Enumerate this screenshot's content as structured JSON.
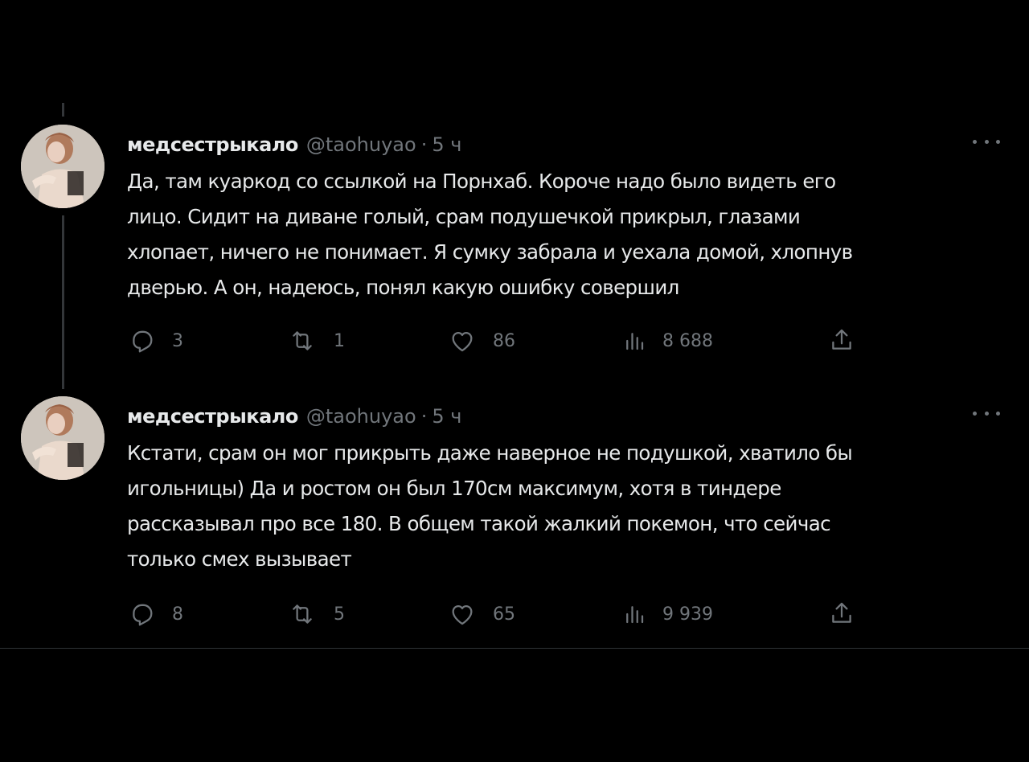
{
  "tweets": [
    {
      "display_name": "медсестрыкало",
      "handle": "@taohuyao",
      "separator": "·",
      "time": "5 ч",
      "text_lines": [
        "Да, там куаркод со ссылкой на Порнхаб. Короче надо было видеть его",
        "лицо. Сидит на диване голый, срам подушечкой прикрыл, глазами",
        "хлопает, ничего не понимает. Я сумку забрала и уехала домой, хлопнув",
        "дверью. А он, надеюсь, понял какую ошибку совершил"
      ],
      "replies": "3",
      "retweets": "1",
      "likes": "86",
      "views": "8 688"
    },
    {
      "display_name": "медсестрыкало",
      "handle": "@taohuyao",
      "separator": "·",
      "time": "5 ч",
      "text_lines": [
        "Кстати, срам он мог прикрыть даже наверное не подушкой, хватило бы",
        "игольницы) Да и ростом он был 170см максимум, хотя в тиндере",
        "рассказывал про все 180. В общем такой жалкий покемон, что сейчас",
        "только смех вызывает"
      ],
      "replies": "8",
      "retweets": "5",
      "likes": "65",
      "views": "9 939"
    }
  ],
  "icons": {
    "reply": "reply-icon",
    "retweet": "retweet-icon",
    "like": "heart-icon",
    "views": "views-icon",
    "share": "share-icon",
    "more": "more-icon"
  },
  "colors": {
    "background": "#000000",
    "text": "#e7e9ea",
    "secondary": "#71767b",
    "divider": "#2f3336"
  }
}
